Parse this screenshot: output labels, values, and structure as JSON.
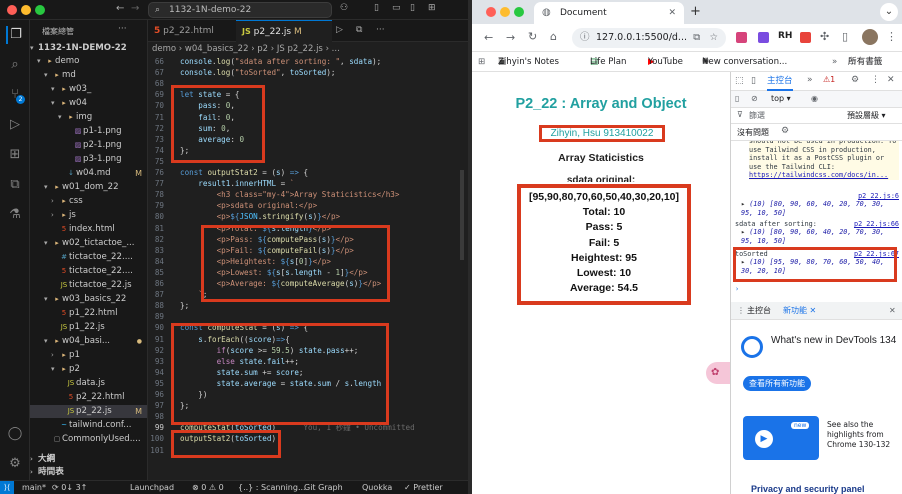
{
  "vscode": {
    "search_text": "1132-1N-demo-22",
    "explorer": {
      "header": "檔案總管",
      "root": "1132-1N-DEMO-22",
      "rows": [
        {
          "name": "demo",
          "indent": 1,
          "type": "folder-open"
        },
        {
          "name": "md",
          "indent": 2,
          "type": "folder-open"
        },
        {
          "name": "w03_",
          "indent": 3,
          "type": "folder-open"
        },
        {
          "name": "w04",
          "indent": 3,
          "type": "folder-open"
        },
        {
          "name": "img",
          "indent": 4,
          "type": "folder-open"
        },
        {
          "name": "p1-1.png",
          "indent": 5,
          "type": "image"
        },
        {
          "name": "p2-1.png",
          "indent": 5,
          "type": "image"
        },
        {
          "name": "p3-1.png",
          "indent": 5,
          "type": "image"
        },
        {
          "name": "w04.md",
          "indent": 4,
          "type": "md",
          "badge": "M"
        },
        {
          "name": "w01_dom_22",
          "indent": 2,
          "type": "folder-open"
        },
        {
          "name": "css",
          "indent": 3,
          "type": "folder"
        },
        {
          "name": "js",
          "indent": 3,
          "type": "folder"
        },
        {
          "name": "index.html",
          "indent": 3,
          "type": "html"
        },
        {
          "name": "w02_tictactoe_...",
          "indent": 2,
          "type": "folder-open"
        },
        {
          "name": "tictactoe_22....",
          "indent": 3,
          "type": "css"
        },
        {
          "name": "tictactoe_22....",
          "indent": 3,
          "type": "html"
        },
        {
          "name": "tictactoe_22.js",
          "indent": 3,
          "type": "js"
        },
        {
          "name": "w03_basics_22",
          "indent": 2,
          "type": "folder-open"
        },
        {
          "name": "p1_22.html",
          "indent": 3,
          "type": "html"
        },
        {
          "name": "p1_22.js",
          "indent": 3,
          "type": "js"
        },
        {
          "name": "w04_basi...",
          "indent": 2,
          "type": "folder-open",
          "dot": true
        },
        {
          "name": "p1",
          "indent": 3,
          "type": "folder"
        },
        {
          "name": "p2",
          "indent": 3,
          "type": "folder-open"
        },
        {
          "name": "data.js",
          "indent": 4,
          "type": "js"
        },
        {
          "name": "p2_22.html",
          "indent": 4,
          "type": "html"
        },
        {
          "name": "p2_22.js",
          "indent": 4,
          "type": "js",
          "badge": "M",
          "selected": true
        },
        {
          "name": "tailwind.conf...",
          "indent": 3,
          "type": "tw"
        },
        {
          "name": "CommonlyUsed....",
          "indent": 2,
          "type": "file"
        }
      ],
      "outline_label": "大綱",
      "timeline_label": "時間表"
    },
    "tabs": [
      {
        "icon": "5",
        "label": "p2_22.html",
        "active": false
      },
      {
        "icon": "JS",
        "label": "p2_22.js",
        "badge": "M",
        "active": true
      }
    ],
    "breadcrumb": "demo › w04_basics_22 › p2 › JS p2_22.js › ...",
    "code_lines": [
      {
        "n": "66",
        "html": "<span class=\"var\">console</span>.<span class=\"fn\">log</span>(<span class=\"str\">\"sdata after sorting: \"</span>, <span class=\"var\">sdata</span>);"
      },
      {
        "n": "67",
        "html": "<span class=\"var\">console</span>.<span class=\"fn\">log</span>(<span class=\"str\">\"toSorted\"</span>, <span class=\"var\">toSorted</span>);"
      },
      {
        "n": "68",
        "html": ""
      },
      {
        "n": "69",
        "html": "<span class=\"kw\">let</span> <span class=\"var\">state</span> = {"
      },
      {
        "n": "70",
        "html": "    <span class=\"var\">pass</span>: <span class=\"num\">0</span>,"
      },
      {
        "n": "71",
        "html": "    <span class=\"var\">fail</span>: <span class=\"num\">0</span>,"
      },
      {
        "n": "72",
        "html": "    <span class=\"var\">sum</span>: <span class=\"num\">0</span>,"
      },
      {
        "n": "73",
        "html": "    <span class=\"var\">average</span>: <span class=\"num\">0</span>"
      },
      {
        "n": "74",
        "html": "};"
      },
      {
        "n": "75",
        "html": ""
      },
      {
        "n": "76",
        "html": "<span class=\"kw\">const</span> <span class=\"fn\">outputStat2</span> = (<span class=\"var\">s</span>) <span class=\"kw\">=></span> {"
      },
      {
        "n": "77",
        "html": "    <span class=\"var\">result1</span>.<span class=\"var\">innerHTML</span> = <span class=\"str\">`</span>"
      },
      {
        "n": "78",
        "html": "        <span class=\"str\">&lt;h3 class=\"my-4\"&gt;Array Staticistics&lt;/h3&gt;</span>"
      },
      {
        "n": "79",
        "html": "        <span class=\"str\">&lt;p&gt;sdata original:&lt;/p&gt;</span>"
      },
      {
        "n": "80",
        "html": "        <span class=\"str\">&lt;p&gt;</span><span class=\"kw\">${</span><span class=\"cn\">JSON</span>.<span class=\"fn\">stringify</span>(<span class=\"var\">s</span>)<span class=\"kw\">}</span><span class=\"str\">&lt;/p&gt;</span>"
      },
      {
        "n": "81",
        "html": "        <span class=\"str\">&lt;p&gt;Total: </span><span class=\"kw\">${</span><span class=\"var\">s</span>.<span class=\"var\">length</span><span class=\"kw\">}</span><span class=\"str\">&lt;/p&gt;</span>"
      },
      {
        "n": "82",
        "html": "        <span class=\"str\">&lt;p&gt;Pass: </span><span class=\"kw\">${</span><span class=\"fn\">computePass</span>(<span class=\"var\">s</span>)<span class=\"kw\">}</span><span class=\"str\">&lt;/p&gt;</span>"
      },
      {
        "n": "83",
        "html": "        <span class=\"str\">&lt;p&gt;Fail: </span><span class=\"kw\">${</span><span class=\"fn\">computeFail</span>(<span class=\"var\">s</span>)<span class=\"kw\">}</span><span class=\"str\">&lt;/p&gt;</span>"
      },
      {
        "n": "84",
        "html": "        <span class=\"str\">&lt;p&gt;Heightest: </span><span class=\"kw\">${</span><span class=\"var\">s</span>[<span class=\"num\">0</span>]<span class=\"kw\">}</span><span class=\"str\">&lt;/p&gt;</span>"
      },
      {
        "n": "85",
        "html": "        <span class=\"str\">&lt;p&gt;Lowest: </span><span class=\"kw\">${</span><span class=\"var\">s</span>[<span class=\"var\">s</span>.<span class=\"var\">length</span> - <span class=\"num\">1</span>]<span class=\"kw\">}</span><span class=\"str\">&lt;/p&gt;</span>"
      },
      {
        "n": "86",
        "html": "        <span class=\"str\">&lt;p&gt;Average: </span><span class=\"kw\">${</span><span class=\"fn\">computeAverage</span>(<span class=\"var\">s</span>)<span class=\"kw\">}</span><span class=\"str\">&lt;/p&gt;</span>"
      },
      {
        "n": "87",
        "html": "    <span class=\"str\">`</span>;"
      },
      {
        "n": "88",
        "html": "};"
      },
      {
        "n": "89",
        "html": ""
      },
      {
        "n": "90",
        "html": "<span class=\"kw\">const</span> <span class=\"fn\">computeStat</span> = (<span class=\"var\">s</span>) <span class=\"kw\">=></span> {"
      },
      {
        "n": "91",
        "html": "    <span class=\"var\">s</span>.<span class=\"fn\">forEach</span>((<span class=\"var\">score</span>)<span class=\"kw\">=></span>{"
      },
      {
        "n": "92",
        "html": "        <span class=\"kw2\">if</span>(<span class=\"var\">score</span> &gt;= <span class=\"num\">59.5</span>) <span class=\"var\">state</span>.<span class=\"var\">pass</span>++;"
      },
      {
        "n": "93",
        "html": "        <span class=\"kw2\">else</span> <span class=\"var\">state</span>.<span class=\"var\">fail</span>++;"
      },
      {
        "n": "94",
        "html": "        <span class=\"var\">state</span>.<span class=\"var\">sum</span> += <span class=\"var\">score</span>;"
      },
      {
        "n": "95",
        "html": "        <span class=\"var\">state</span>.<span class=\"var\">average</span> = <span class=\"var\">state</span>.<span class=\"var\">sum</span> / <span class=\"var\">s</span>.<span class=\"var\">length</span>"
      },
      {
        "n": "96",
        "html": "    })"
      },
      {
        "n": "97",
        "html": "};"
      },
      {
        "n": "98",
        "html": ""
      },
      {
        "n": "99",
        "html": "<span class=\"fn\">computeStat</span>(<span class=\"var\">toSorted</span>)      <span class=\"cm\">You, 1 秒鐘 • Uncommitted</span>",
        "current": true
      },
      {
        "n": "100",
        "html": "<span class=\"fn\">outputStat2</span>(<span class=\"var\">toSorted</span>)"
      },
      {
        "n": "101",
        "html": ""
      }
    ],
    "status": {
      "branch": "main*",
      "sync": "⟳ 0↓ 3↑",
      "launchpad": "Launchpad",
      "problems": "⊗ 0 ⚠ 0",
      "scanning": "{..} : Scanning...",
      "gitgraph": "Git Graph",
      "quokka": "Quokka",
      "prettier": "✓ Prettier"
    }
  },
  "chrome": {
    "tab_title": "Document",
    "url": "127.0.0.1:5500/d...",
    "bookmarks": [
      "Zihyin's Notes",
      "Life Plan",
      "YouTube",
      "New conversation...",
      "所有書籤"
    ],
    "page": {
      "title": "P2_22 : Array and Object",
      "author": "Zihyin, Hsu 913410022",
      "heading": "Array Staticistics",
      "sdata_label": "sdata original:",
      "array": "[95,90,80,70,60,50,40,30,20,10]",
      "total": "Total: 10",
      "pass": "Pass: 5",
      "fail": "Fail: 5",
      "highest": "Heightest: 95",
      "lowest": "Lowest: 10",
      "average": "Average: 54.5"
    },
    "devtools": {
      "tabs": [
        "主控台",
        "»",
        "⚠1",
        "⚙",
        "⋮",
        "✕"
      ],
      "top_context": "top ▾",
      "filter_placeholder": "篩選",
      "level": "預設層級 ▾",
      "no_issues": "沒有問題",
      "tailwind_warning": "should not be used in production. To use Tailwind CSS in production, install it as a PostCSS plugin or use the Tailwind CLI:",
      "tailwind_link": "https://tailwindcss.com/docs/in...",
      "log1_src": "p2_22.js:6",
      "log1_text": "(10) [80, 90, 60, 40, 20, 70, 30, 95, 10, 50]",
      "log2_label": "sdata after sorting:",
      "log2_src": "p2_22.js:66",
      "log2_text": "(10) [80, 90, 60, 40, 20, 70, 30, 95, 10, 50]",
      "log3_label": "toSorted",
      "log3_src": "p2_22.js:67",
      "log3_text": "(10) [95, 90, 80, 70, 60, 50, 40, 30, 20, 10]",
      "drawer_tabs": [
        "主控台",
        "新功能"
      ],
      "whatsnew_title": "What's new in DevTools 134",
      "whatsnew_btn": "查看所有新功能",
      "see_also": "See also the highlights from Chrome 130-132",
      "new_badge": "new",
      "privacy": "Privacy and security panel"
    }
  },
  "colors": {
    "highlight": "#d93a1e",
    "teal": "#21a0a0"
  }
}
